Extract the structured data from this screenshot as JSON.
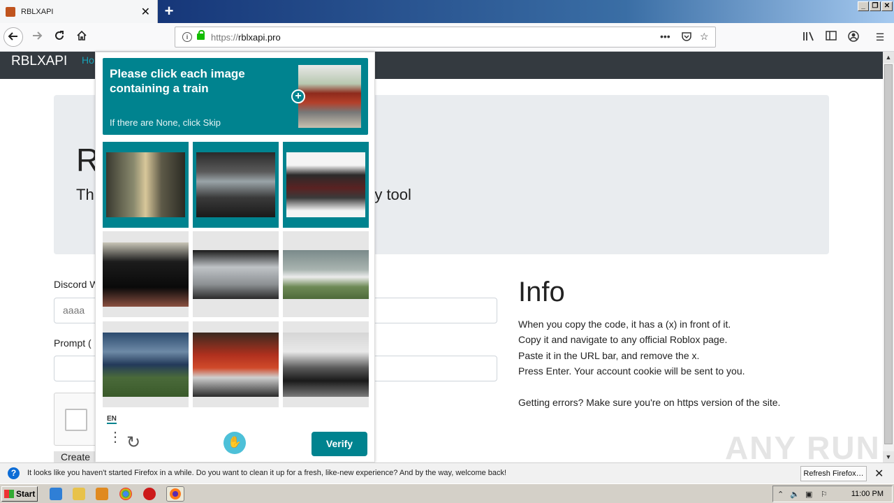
{
  "browser": {
    "tab_title": "RBLXAPI",
    "url_domain": "rblxapi.pro",
    "url_scheme": "https://",
    "new_tab": "+",
    "tab_close": "✕"
  },
  "site": {
    "brand": "RBLXAPI",
    "nav_link": "Ho",
    "jumbo_title_visible": "R",
    "jumbo_lead_left": "Th",
    "jumbo_lead_right": "ry tool",
    "label_discord": "Discord W",
    "discord_value": "aaaa",
    "label_prompt": "Prompt (",
    "create_button": "Create",
    "info_heading": "Info",
    "info_lines": [
      "When you copy the code, it has a (x) in front of it.",
      "Copy it and navigate to any official Roblox page.",
      "Paste it in the URL bar, and remove the x.",
      "Press Enter. Your account cookie will be sent to you.",
      "Getting errors? Make sure you're on https version of the site."
    ]
  },
  "captcha": {
    "prompt": "Please click each image containing a train",
    "hint": "If there are None, click Skip",
    "language": "EN",
    "verify_label": "Verify",
    "tiles": [
      {
        "subject": "subway train",
        "selected": true
      },
      {
        "subject": "train window",
        "selected": true
      },
      {
        "subject": "steam locomotive",
        "selected": true
      },
      {
        "subject": "black sports car",
        "selected": false
      },
      {
        "subject": "silver sedan",
        "selected": false
      },
      {
        "subject": "small airplane",
        "selected": false
      },
      {
        "subject": "freight locomotive",
        "selected": false
      },
      {
        "subject": "red classic car",
        "selected": false
      },
      {
        "subject": "person near airplane",
        "selected": false
      }
    ],
    "colors": {
      "accent": "#00838f"
    }
  },
  "notification": {
    "message": "It looks like you haven't started Firefox in a while. Do you want to clean it up for a fresh, like-new experience? And by the way, welcome back!",
    "button": "Refresh Firefox…"
  },
  "taskbar": {
    "start_label": "Start",
    "clock": "11:00 PM"
  },
  "watermark": "ANY RUN"
}
